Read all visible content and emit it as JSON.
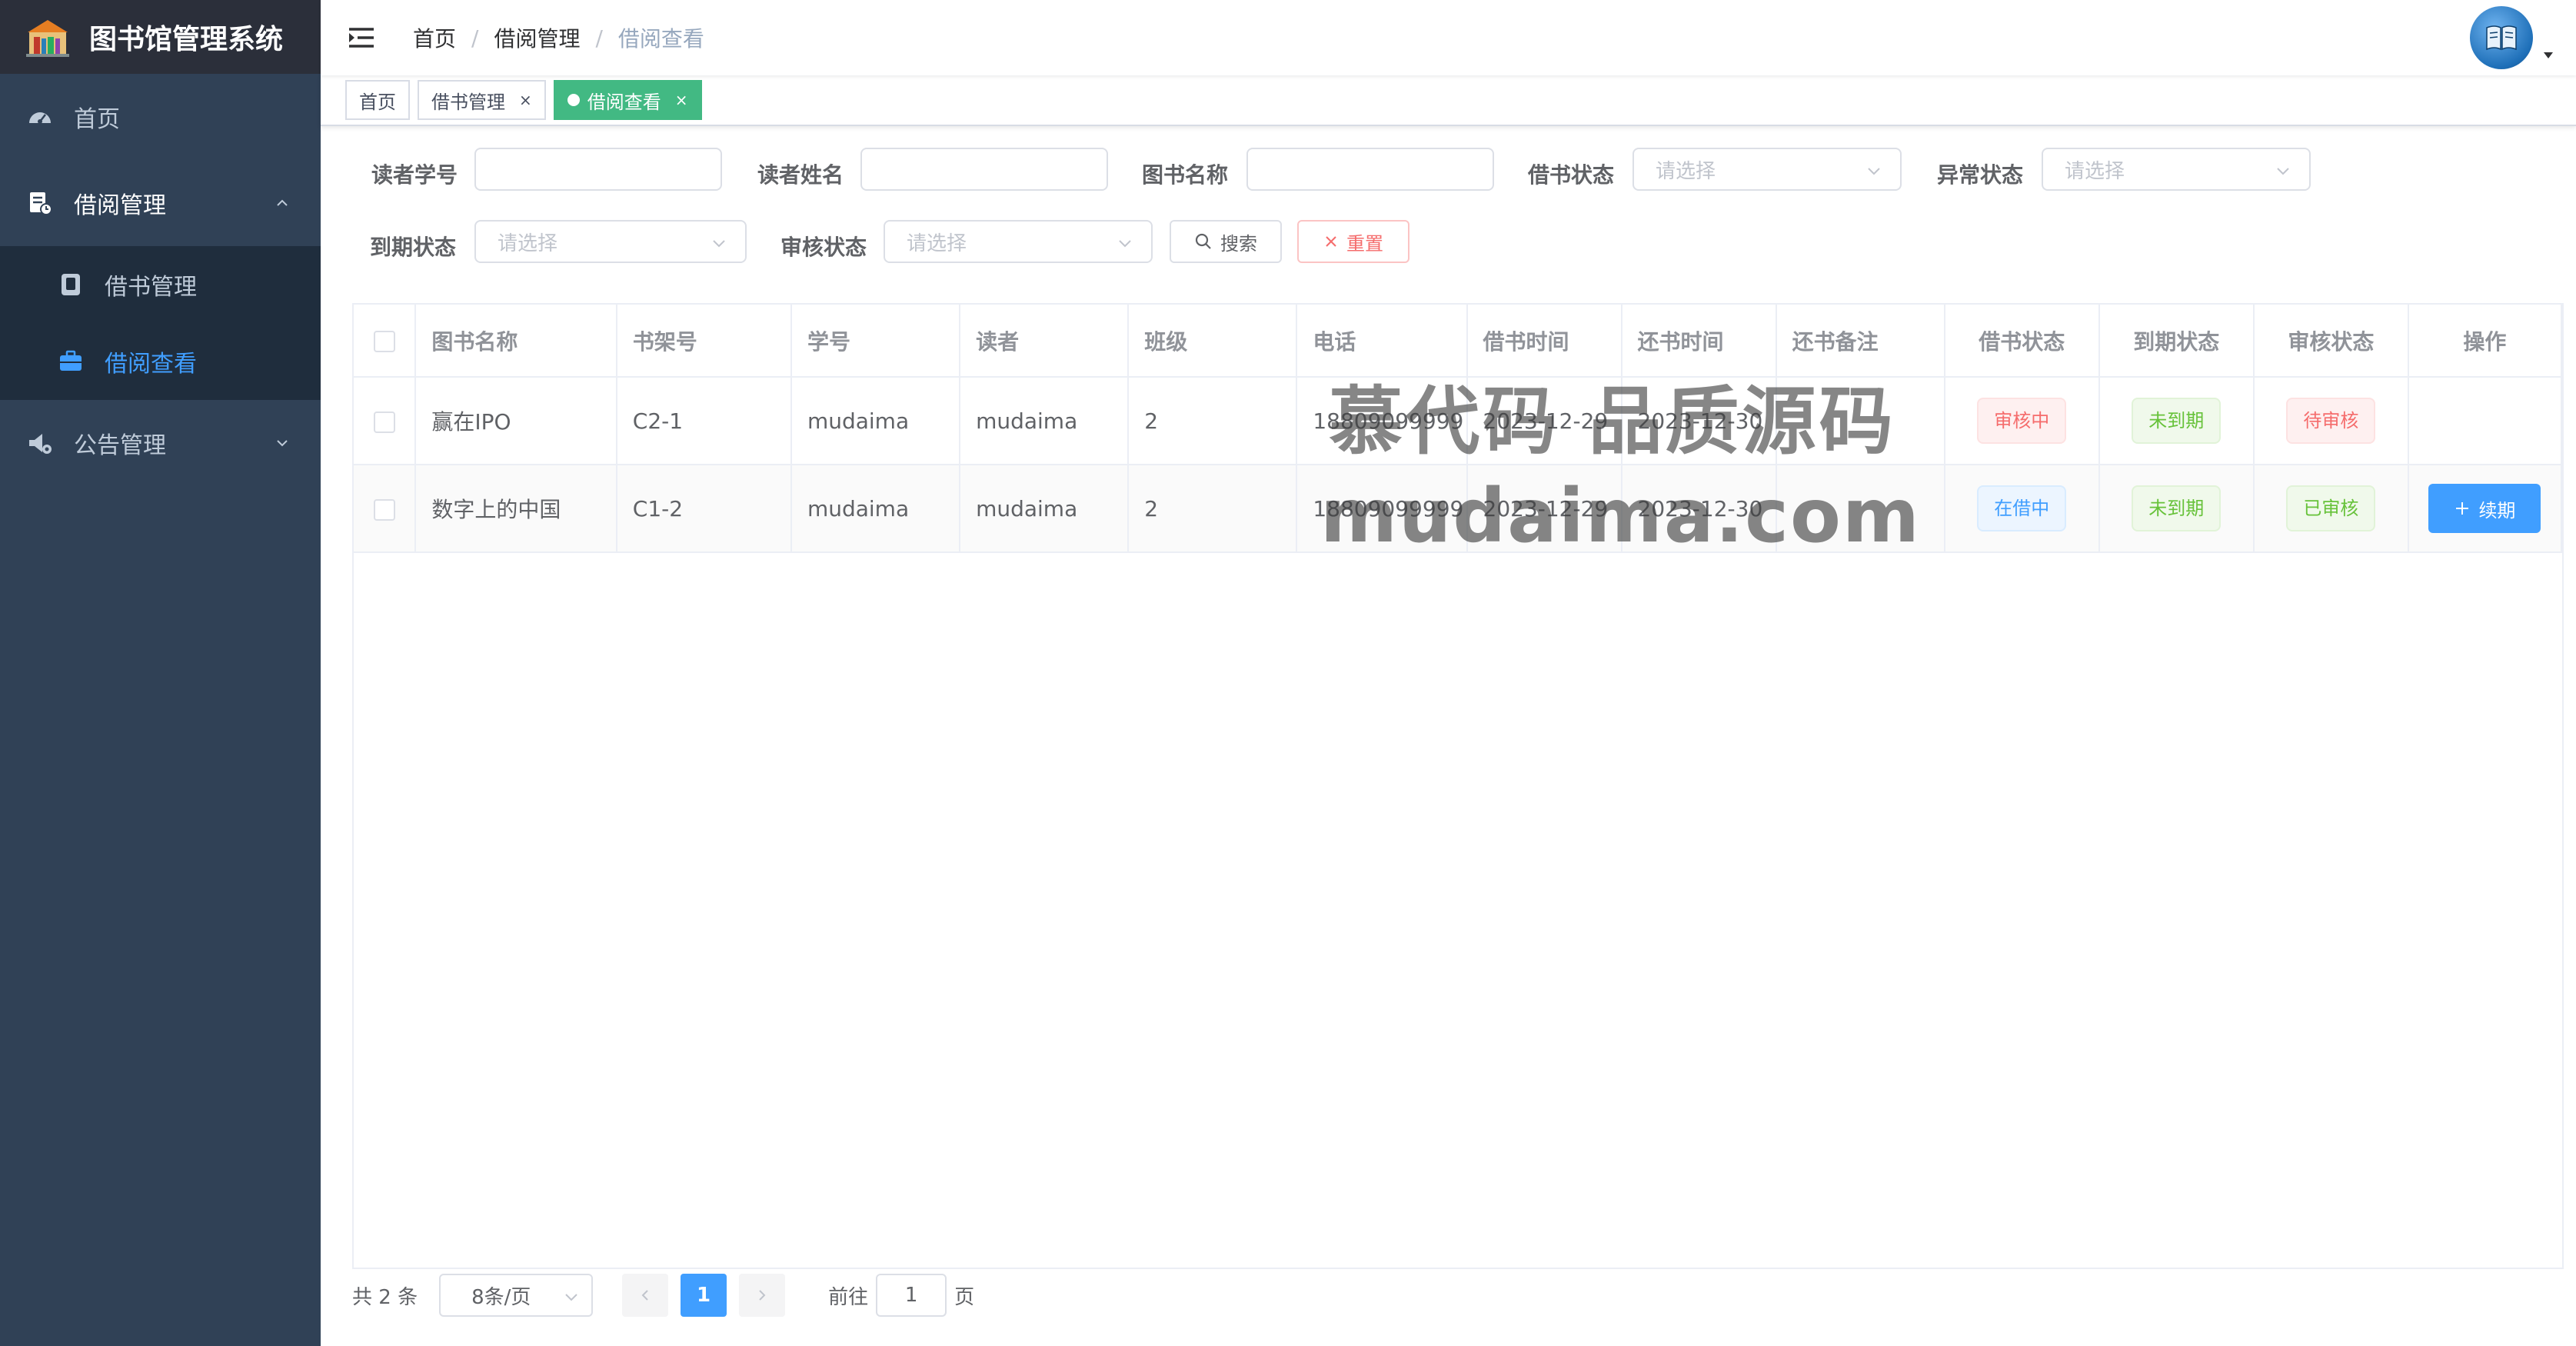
{
  "app": {
    "title": "图书馆管理系统"
  },
  "sidebar": {
    "items": [
      {
        "label": "首页",
        "icon": "dashboard-icon"
      },
      {
        "label": "借阅管理",
        "icon": "borrow-manage-icon",
        "expanded": true,
        "children": [
          {
            "label": "借书管理",
            "icon": "book-icon"
          },
          {
            "label": "借阅查看",
            "icon": "briefcase-icon",
            "active": true
          }
        ]
      },
      {
        "label": "公告管理",
        "icon": "announcement-icon",
        "expanded": false
      }
    ]
  },
  "breadcrumb": [
    "首页",
    "借阅管理",
    "借阅查看"
  ],
  "tags": [
    {
      "label": "首页",
      "closable": false,
      "active": false
    },
    {
      "label": "借书管理",
      "closable": true,
      "active": false
    },
    {
      "label": "借阅查看",
      "closable": true,
      "active": true
    }
  ],
  "search": {
    "reader_id_label": "读者学号",
    "reader_name_label": "读者姓名",
    "book_name_label": "图书名称",
    "borrow_status_label": "借书状态",
    "abnormal_status_label": "异常状态",
    "due_status_label": "到期状态",
    "review_status_label": "审核状态",
    "select_placeholder": "请选择",
    "search_button": "搜索",
    "reset_button": "重置"
  },
  "table": {
    "columns": [
      "图书名称",
      "书架号",
      "学号",
      "读者",
      "班级",
      "电话",
      "借书时间",
      "还书时间",
      "还书备注",
      "借书状态",
      "到期状态",
      "审核状态",
      "操作"
    ],
    "rows": [
      {
        "book": "赢在IPO",
        "shelf": "C2-1",
        "student_id": "mudaima",
        "reader": "mudaima",
        "class": "2",
        "phone": "18809099999",
        "borrow_date": "2023-12-29",
        "return_date": "2023-12-30",
        "note": "",
        "borrow_status": "审核中",
        "due_status": "未到期",
        "review_status": "待审核",
        "action": ""
      },
      {
        "book": "数字上的中国",
        "shelf": "C1-2",
        "student_id": "mudaima",
        "reader": "mudaima",
        "class": "2",
        "phone": "18809099999",
        "borrow_date": "2023-12-29",
        "return_date": "2023-12-30",
        "note": "",
        "borrow_status": "在借中",
        "due_status": "未到期",
        "review_status": "已审核",
        "action": "续期"
      }
    ]
  },
  "pagination": {
    "total": "共 2 条",
    "page_size": "8条/页",
    "current_page": "1",
    "goto_label": "前往",
    "goto_value": "1",
    "page_suffix": "页"
  },
  "watermark": {
    "line1": "慕代码 品质源码",
    "line2": "mudaima.com"
  },
  "colors": {
    "sidebar_bg": "#304156",
    "accent": "#409eff",
    "tag_active": "#42b983",
    "danger": "#f56c6c",
    "success": "#67c23a"
  }
}
